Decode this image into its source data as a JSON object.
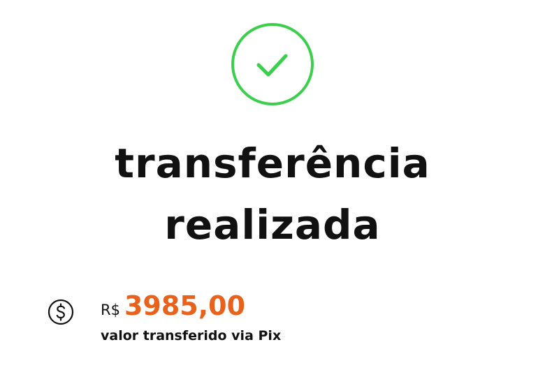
{
  "status": {
    "icon": "check-circle-icon",
    "color": "#3ccf4e"
  },
  "title": {
    "line1": "transferência",
    "line2": "realizada"
  },
  "transfer": {
    "icon": "dollar-circle-icon",
    "currency": "R$",
    "amount": "3985,00",
    "amount_color": "#e8621c",
    "caption": "valor transferido via Pix"
  }
}
